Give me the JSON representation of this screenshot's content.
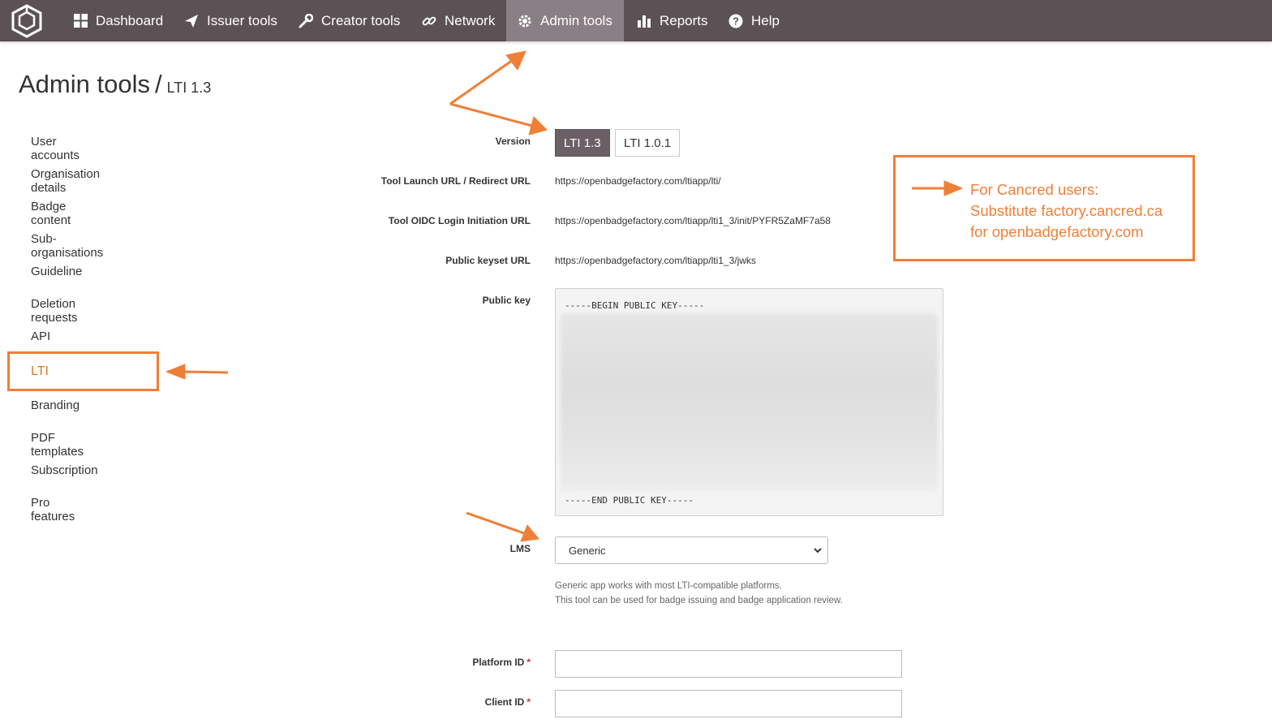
{
  "nav": {
    "items": [
      {
        "label": "Dashboard",
        "icon": "dashboard-icon"
      },
      {
        "label": "Issuer tools",
        "icon": "send-icon"
      },
      {
        "label": "Creator tools",
        "icon": "wrench-icon"
      },
      {
        "label": "Network",
        "icon": "link-icon"
      },
      {
        "label": "Admin tools",
        "icon": "gear-icon",
        "active": true
      },
      {
        "label": "Reports",
        "icon": "bar-chart-icon"
      },
      {
        "label": "Help",
        "icon": "help-icon"
      }
    ]
  },
  "title": {
    "main": "Admin tools",
    "separator": "/",
    "sub": "LTI 1.3"
  },
  "sidebar": {
    "items": [
      {
        "label": "User accounts"
      },
      {
        "label": "Organisation details"
      },
      {
        "label": "Badge content"
      },
      {
        "label": "Sub-organisations"
      },
      {
        "label": "Guideline"
      },
      {
        "label": "Deletion requests"
      },
      {
        "label": "API"
      },
      {
        "label": "LTI",
        "active": true
      },
      {
        "label": "Branding"
      },
      {
        "label": "PDF templates"
      },
      {
        "label": "Subscription"
      },
      {
        "label": "Pro features"
      }
    ]
  },
  "form": {
    "version_label": "Version",
    "version_options": [
      "LTI 1.3",
      "LTI 1.0.1"
    ],
    "launch_label": "Tool Launch URL / Redirect URL",
    "launch_value": "https://openbadgefactory.com/ltiapp/lti/",
    "oidc_label": "Tool OIDC Login Initiation URL",
    "oidc_value": "https://openbadgefactory.com/ltiapp/lti1_3/init/PYFR5ZaMF7a58",
    "keyset_label": "Public keyset URL",
    "keyset_value": "https://openbadgefactory.com/ltiapp/lti1_3/jwks",
    "pubkey_label": "Public key",
    "pubkey_begin": "-----BEGIN PUBLIC KEY-----",
    "pubkey_end": "-----END PUBLIC KEY-----",
    "lms_label": "LMS",
    "lms_value": "Generic",
    "lms_help_1": "Generic app works with most LTI-compatible platforms.",
    "lms_help_2": "This tool can be used for badge issuing and badge application review.",
    "platform_id_label": "Platform ID",
    "client_id_label": "Client ID",
    "required_mark": "*"
  },
  "annotation": {
    "line1": "For Cancred users:",
    "line2": "Substitute factory.cancred.ca",
    "line3": "for openbadgefactory.com",
    "color": "#ef7f37"
  }
}
